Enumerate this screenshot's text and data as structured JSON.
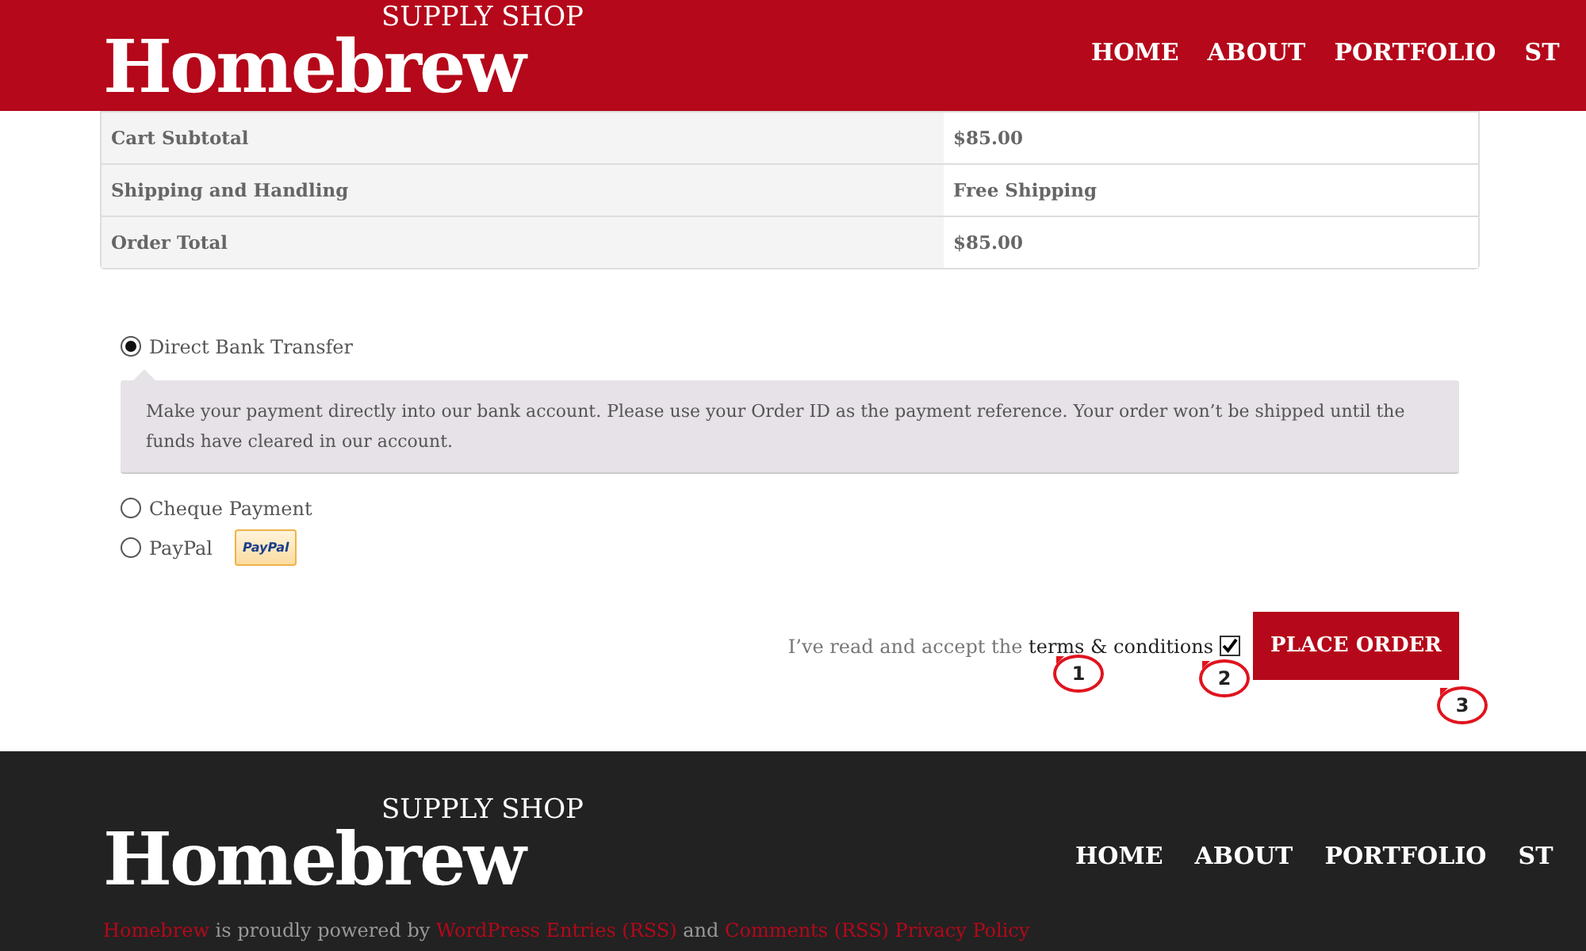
{
  "header": {
    "logo": "Homebrew",
    "tagline": "SUPPLY SHOP",
    "nav": [
      "HOME",
      "ABOUT",
      "PORTFOLIO",
      "ST"
    ]
  },
  "totals": [
    {
      "label": "Cart Subtotal",
      "value": "$85.00"
    },
    {
      "label": "Shipping and Handling",
      "value": "Free Shipping"
    },
    {
      "label": "Order Total",
      "value": "$85.00"
    }
  ],
  "payment_methods": [
    {
      "label": "Direct Bank Transfer",
      "selected": true,
      "description": "Make your payment directly into our bank account. Please use your Order ID as the payment reference. Your order won’t be shipped until the funds have cleared in our account."
    },
    {
      "label": "Cheque Payment",
      "selected": false
    },
    {
      "label": "PayPal",
      "selected": false,
      "badge": "PayPal"
    }
  ],
  "terms": {
    "text": "I’ve read and accept the",
    "link": "terms & conditions",
    "checked": true
  },
  "place_order": "PLACE ORDER",
  "callouts": [
    "1",
    "2",
    "3"
  ],
  "footer": {
    "logo": "Homebrew",
    "tagline": "SUPPLY SHOP",
    "nav": [
      "HOME",
      "ABOUT",
      "PORTFOLIO",
      "ST"
    ],
    "credits": [
      {
        "text": "Homebrew",
        "link": true
      },
      {
        "text": "is proudly powered by",
        "link": false
      },
      {
        "text": "WordPress",
        "link": true
      },
      {
        "text": "Entries (RSS)",
        "link": true
      },
      {
        "text": "and",
        "link": false
      },
      {
        "text": "Comments (RSS)",
        "link": true
      },
      {
        "text": "Privacy Policy",
        "link": true
      }
    ]
  }
}
